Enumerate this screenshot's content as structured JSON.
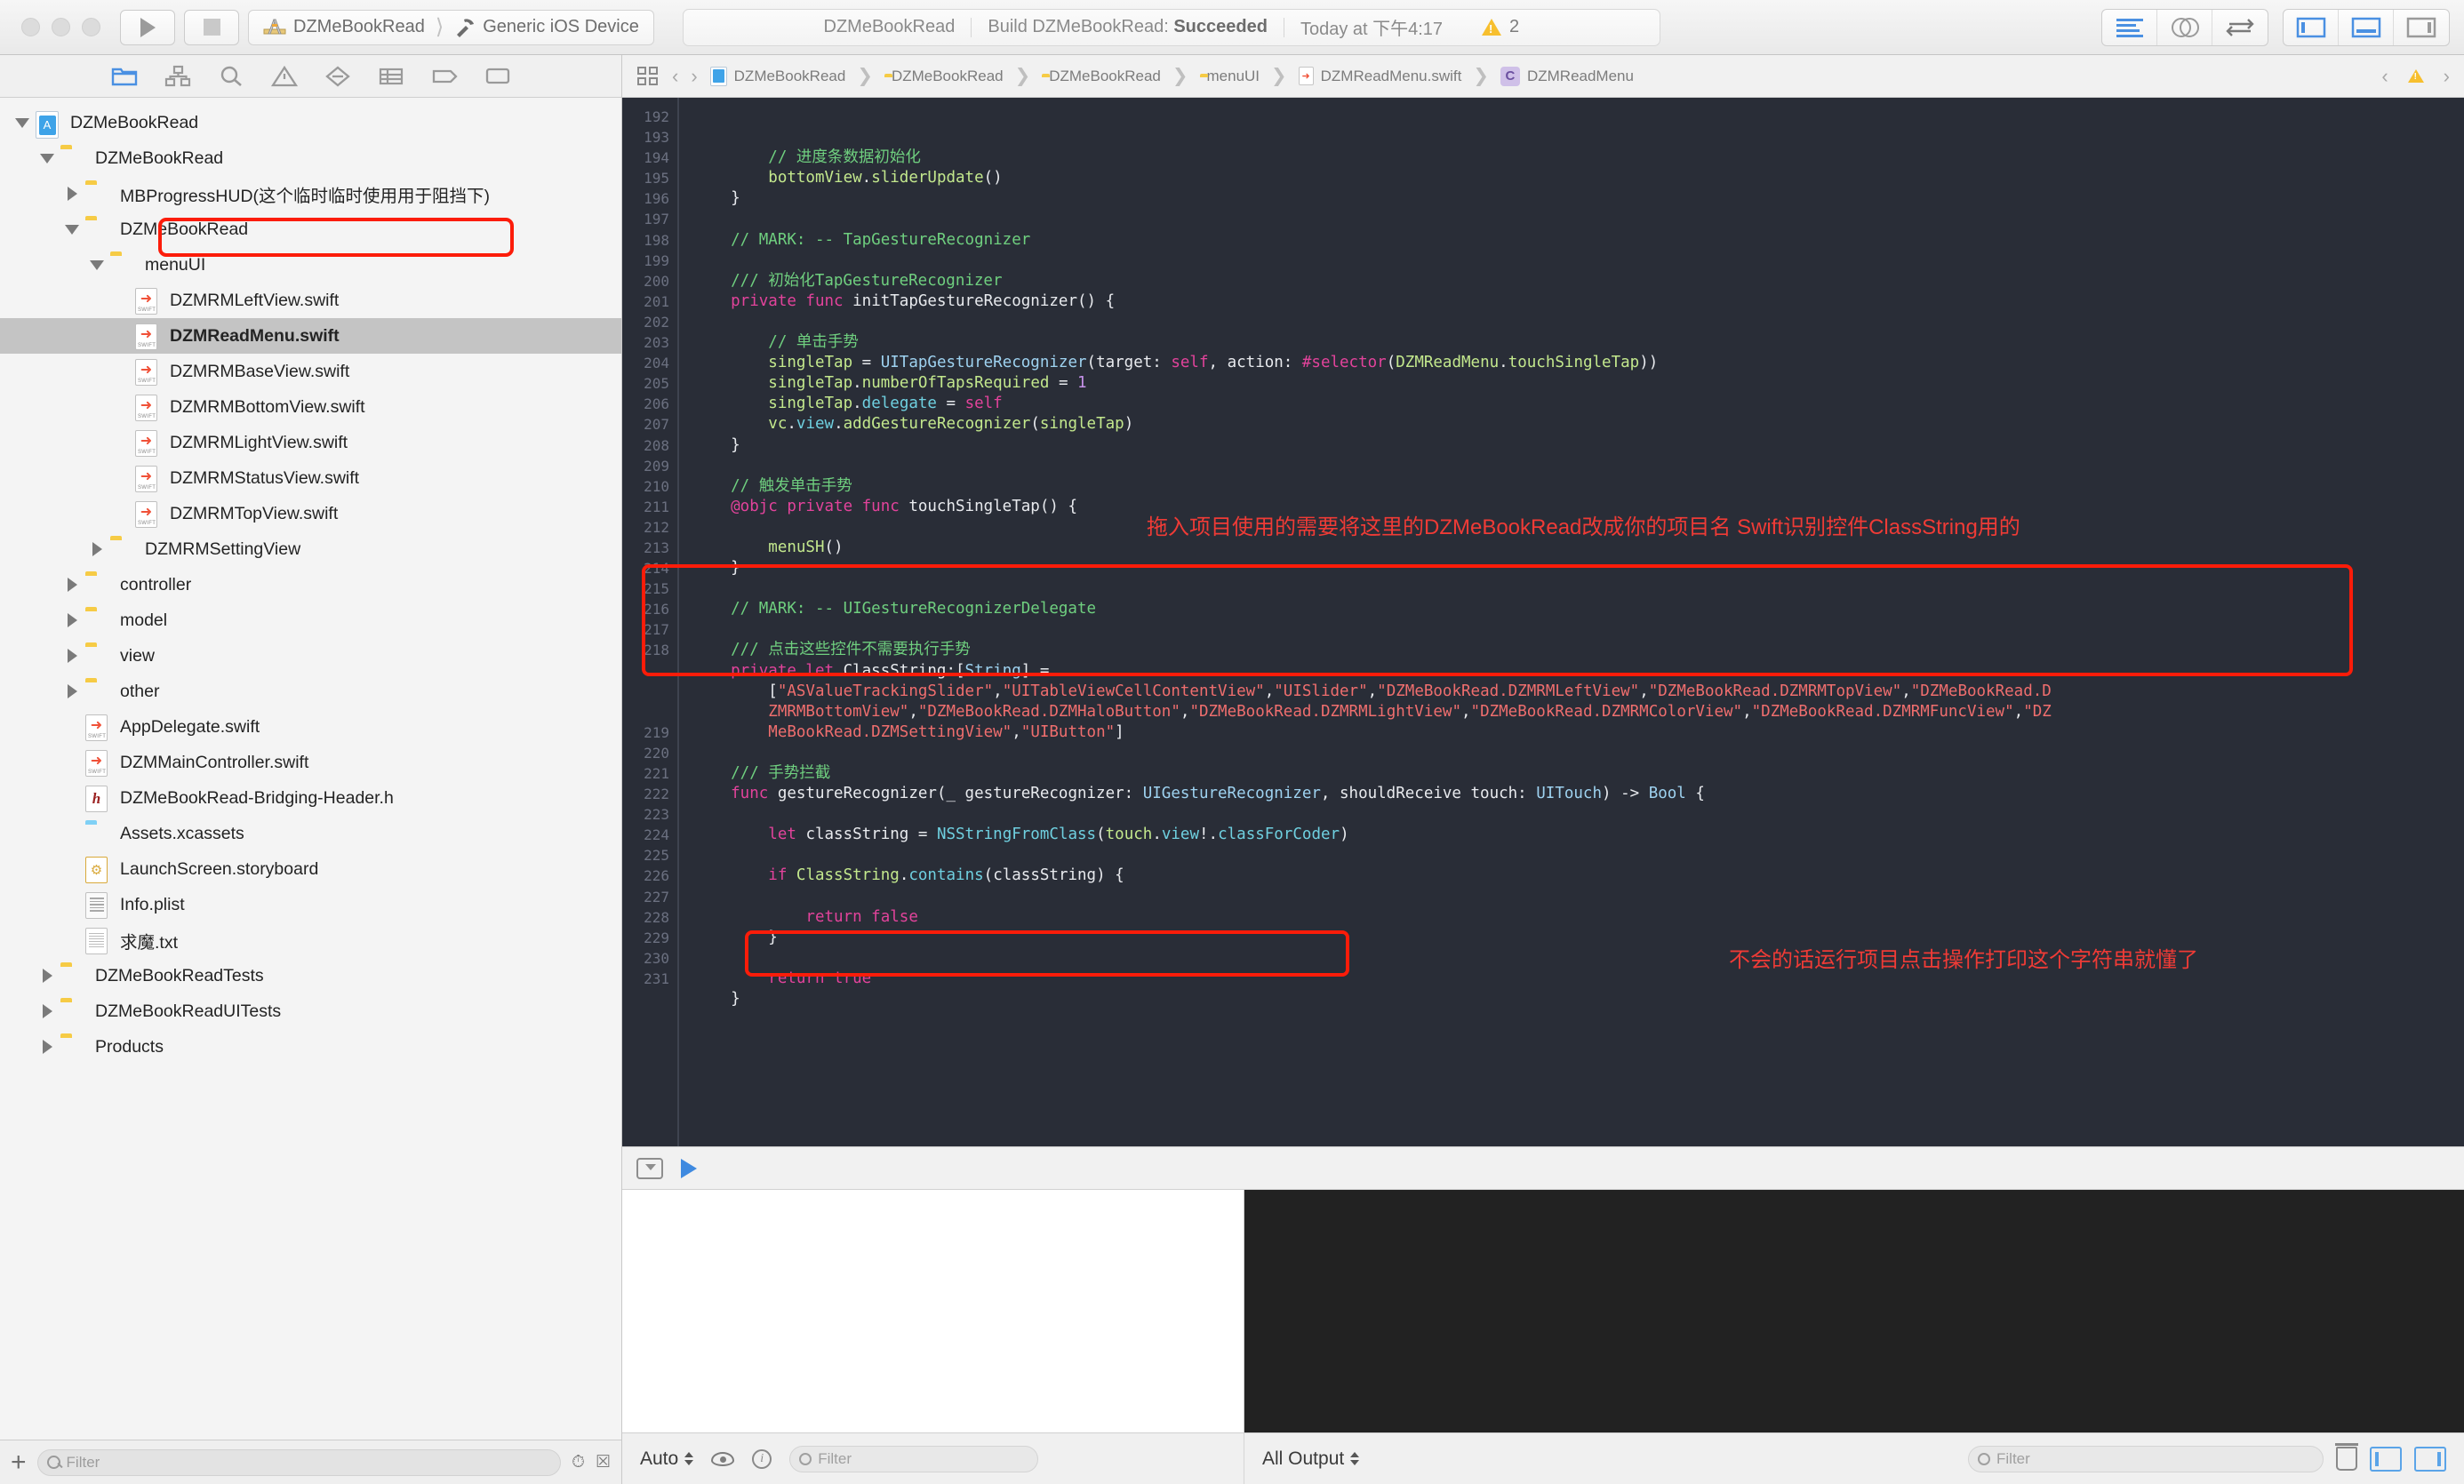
{
  "toolbar": {
    "run_label": "Run",
    "stop_label": "Stop",
    "scheme_name": "DZMeBookRead",
    "destination": "Generic iOS Device",
    "status_project": "DZMeBookRead",
    "status_action_prefix": "Build DZMeBookRead: ",
    "status_action_result": "Succeeded",
    "status_time": "Today at 下午4:17",
    "warning_count": "2",
    "editor_buttons": [
      "standard-editor",
      "assistant-editor",
      "version-editor"
    ],
    "view_buttons": [
      "navigator-toggle",
      "debug-area-toggle",
      "utilities-toggle"
    ]
  },
  "navigator": {
    "tabs": [
      "project-navigator",
      "symbol-navigator",
      "find-navigator",
      "issue-navigator",
      "test-navigator",
      "report-navigator",
      "debug-navigator",
      "breakpoint-navigator"
    ],
    "tree": [
      {
        "label": "DZMeBookRead",
        "icon": "app",
        "depth": 0,
        "twisty": "down"
      },
      {
        "label": "DZMeBookRead",
        "icon": "folder",
        "depth": 1,
        "twisty": "down"
      },
      {
        "label": "MBProgressHUD(这个临时临时使用用于阻挡下)",
        "icon": "folder",
        "depth": 2,
        "twisty": "right"
      },
      {
        "label": "DZMeBookRead",
        "icon": "folder",
        "depth": 2,
        "twisty": "down"
      },
      {
        "label": "menuUI",
        "icon": "folder",
        "depth": 3,
        "twisty": "down"
      },
      {
        "label": "DZMRMLeftView.swift",
        "icon": "swift",
        "depth": 4,
        "twisty": ""
      },
      {
        "label": "DZMReadMenu.swift",
        "icon": "swift",
        "depth": 4,
        "twisty": "",
        "selected": true,
        "highlighted": true
      },
      {
        "label": "DZMRMBaseView.swift",
        "icon": "swift",
        "depth": 4,
        "twisty": ""
      },
      {
        "label": "DZMRMBottomView.swift",
        "icon": "swift",
        "depth": 4,
        "twisty": ""
      },
      {
        "label": "DZMRMLightView.swift",
        "icon": "swift",
        "depth": 4,
        "twisty": ""
      },
      {
        "label": "DZMRMStatusView.swift",
        "icon": "swift",
        "depth": 4,
        "twisty": ""
      },
      {
        "label": "DZMRMTopView.swift",
        "icon": "swift",
        "depth": 4,
        "twisty": ""
      },
      {
        "label": "DZMRMSettingView",
        "icon": "folder",
        "depth": 3,
        "twisty": "right"
      },
      {
        "label": "controller",
        "icon": "folder",
        "depth": 2,
        "twisty": "right"
      },
      {
        "label": "model",
        "icon": "folder",
        "depth": 2,
        "twisty": "right"
      },
      {
        "label": "view",
        "icon": "folder",
        "depth": 2,
        "twisty": "right"
      },
      {
        "label": "other",
        "icon": "folder",
        "depth": 2,
        "twisty": "right"
      },
      {
        "label": "AppDelegate.swift",
        "icon": "swift",
        "depth": 2,
        "twisty": ""
      },
      {
        "label": "DZMMainController.swift",
        "icon": "swift",
        "depth": 2,
        "twisty": ""
      },
      {
        "label": "DZMeBookRead-Bridging-Header.h",
        "icon": "header",
        "depth": 2,
        "twisty": ""
      },
      {
        "label": "Assets.xcassets",
        "icon": "assets",
        "depth": 2,
        "twisty": ""
      },
      {
        "label": "LaunchScreen.storyboard",
        "icon": "storyboard",
        "depth": 2,
        "twisty": ""
      },
      {
        "label": "Info.plist",
        "icon": "plist",
        "depth": 2,
        "twisty": ""
      },
      {
        "label": "求魔.txt",
        "icon": "text",
        "depth": 2,
        "twisty": ""
      },
      {
        "label": "DZMeBookReadTests",
        "icon": "folder",
        "depth": 1,
        "twisty": "right"
      },
      {
        "label": "DZMeBookReadUITests",
        "icon": "folder",
        "depth": 1,
        "twisty": "right"
      },
      {
        "label": "Products",
        "icon": "folder",
        "depth": 1,
        "twisty": "right"
      }
    ],
    "footer": {
      "add_label": "+",
      "filter_placeholder": "Filter",
      "recent_icon": "clock-icon",
      "clear_icon": "clear-filter-icon"
    }
  },
  "jumpbar": {
    "related_items_icon": "related-items-icon",
    "back_label": "‹",
    "forward_label": "›",
    "crumbs": [
      {
        "label": "DZMeBookRead",
        "icon": "app"
      },
      {
        "label": "DZMeBookRead",
        "icon": "folder"
      },
      {
        "label": "DZMeBookRead",
        "icon": "folder"
      },
      {
        "label": "menuUI",
        "icon": "folder"
      },
      {
        "label": "DZMReadMenu.swift",
        "icon": "swift"
      },
      {
        "label": "DZMReadMenu",
        "icon": "class"
      }
    ]
  },
  "editor": {
    "first_line_number": 192,
    "lines": [
      {
        "n": "192",
        "code": ""
      },
      {
        "n": "193",
        "code": "        // 进度条数据初始化",
        "type": "comment"
      },
      {
        "n": "194",
        "code": "        bottomView.sliderUpdate()"
      },
      {
        "n": "195",
        "code": "    }"
      },
      {
        "n": "196",
        "code": ""
      },
      {
        "n": "197",
        "code": "    // MARK: -- TapGestureRecognizer",
        "type": "comment"
      },
      {
        "n": "198",
        "code": ""
      },
      {
        "n": "199",
        "code": "    /// 初始化TapGestureRecognizer",
        "type": "comment"
      },
      {
        "n": "200",
        "code": "    private func initTapGestureRecognizer() {"
      },
      {
        "n": "201",
        "code": ""
      },
      {
        "n": "202",
        "code": "        // 单击手势",
        "type": "comment"
      },
      {
        "n": "203",
        "code": "        singleTap = UITapGestureRecognizer(target: self, action: #selector(DZMReadMenu.touchSingleTap))"
      },
      {
        "n": "204",
        "code": "        singleTap.numberOfTapsRequired = 1"
      },
      {
        "n": "205",
        "code": "        singleTap.delegate = self"
      },
      {
        "n": "206",
        "code": "        vc.view.addGestureRecognizer(singleTap)"
      },
      {
        "n": "207",
        "code": "    }"
      },
      {
        "n": "208",
        "code": ""
      },
      {
        "n": "209",
        "code": "    // 触发单击手势",
        "type": "comment"
      },
      {
        "n": "210",
        "code": "    @objc private func touchSingleTap() {"
      },
      {
        "n": "211",
        "code": ""
      },
      {
        "n": "212",
        "code": "        menuSH()"
      },
      {
        "n": "213",
        "code": "    }"
      },
      {
        "n": "214",
        "code": ""
      },
      {
        "n": "215",
        "code": "    // MARK: -- UIGestureRecognizerDelegate",
        "type": "comment"
      },
      {
        "n": "216",
        "code": ""
      },
      {
        "n": "217",
        "code": "    /// 点击这些控件不需要执行手势",
        "type": "comment"
      },
      {
        "n": "218",
        "code": "    private let ClassString:[String] ="
      },
      {
        "n": "218b",
        "code": "        [\"ASValueTrackingSlider\",\"UITableViewCellContentView\",\"UISlider\",\"DZMeBookRead.DZMRMLeftView\",\"DZMeBookRead.DZMRMTopView\",\"DZMeBookRead.D"
      },
      {
        "n": "218c",
        "code": "        ZMRMBottomView\",\"DZMeBookRead.DZMHaloButton\",\"DZMeBookRead.DZMRMLightView\",\"DZMeBookRead.DZMRMColorView\",\"DZMeBookRead.DZMRMFuncView\",\"DZ"
      },
      {
        "n": "218d",
        "code": "        MeBookRead.DZMSettingView\",\"UIButton\"]"
      },
      {
        "n": "219",
        "code": ""
      },
      {
        "n": "220",
        "code": "    /// 手势拦截",
        "type": "comment"
      },
      {
        "n": "221",
        "code": "    func gestureRecognizer(_ gestureRecognizer: UIGestureRecognizer, shouldReceive touch: UITouch) -> Bool {"
      },
      {
        "n": "222",
        "code": ""
      },
      {
        "n": "223",
        "code": "        let classString = NSStringFromClass(touch.view!.classForCoder)"
      },
      {
        "n": "224",
        "code": ""
      },
      {
        "n": "225",
        "code": "        if ClassString.contains(classString) {"
      },
      {
        "n": "226",
        "code": ""
      },
      {
        "n": "227",
        "code": "            return false"
      },
      {
        "n": "228",
        "code": "        }"
      },
      {
        "n": "229",
        "code": ""
      },
      {
        "n": "230",
        "code": "        return true"
      },
      {
        "n": "231",
        "code": "    }"
      }
    ],
    "annotations": [
      {
        "id": "annot-project-name",
        "text": "拖入项目使用的需要将这里的DZMeBookRead改成你的项目名 Swift识别控件ClassString用的"
      },
      {
        "id": "annot-print-string",
        "text": "不会的话运行项目点击操作打印这个字符串就懂了"
      }
    ]
  },
  "debug_area": {
    "toolbar_icons": [
      "hide-debug-icon",
      "step-icon"
    ],
    "variables_scope_label": "Auto",
    "variables_filter_placeholder": "Filter",
    "console_scope_label": "All Output",
    "console_filter_placeholder": "Filter",
    "trash_icon": "clear-console-icon",
    "pane_icons": [
      "variables-pane-icon",
      "console-pane-icon"
    ]
  },
  "colors": {
    "accent": "#3f8ae0",
    "annotation_red": "#fb1c09",
    "editor_bg": "#292d37",
    "success_text": "#6c6c6c",
    "warning_yellow": "#f7bf2e"
  }
}
